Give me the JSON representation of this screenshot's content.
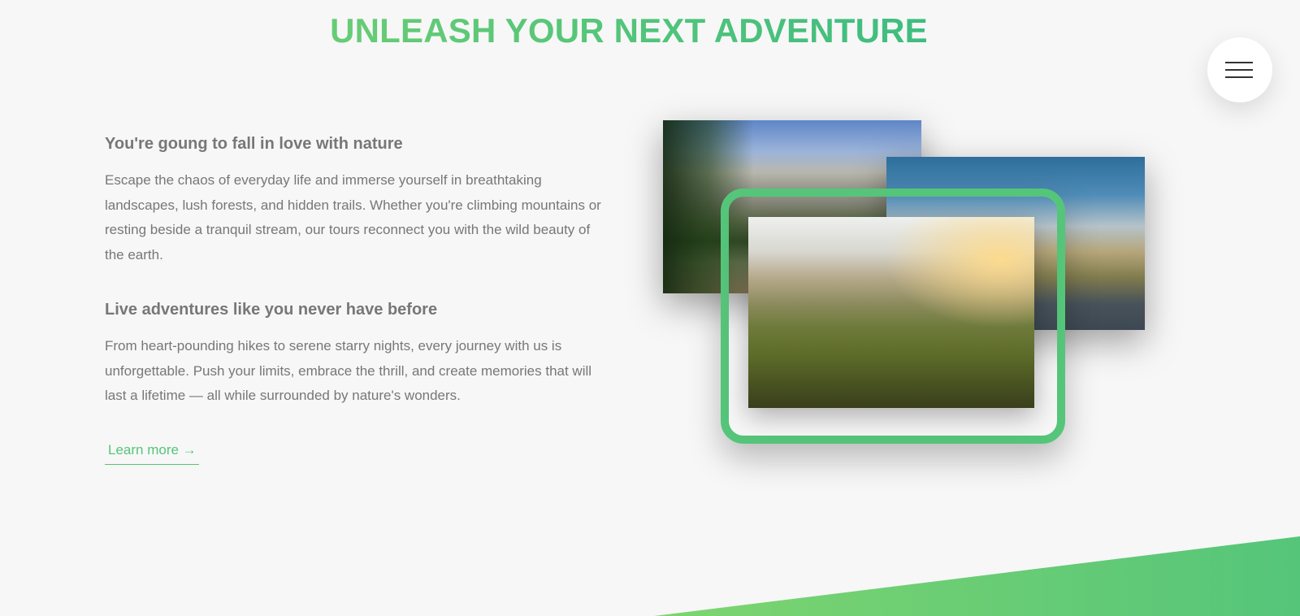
{
  "page": {
    "heading": "UNLEASH YOUR NEXT ADVENTURE"
  },
  "nav": {
    "icon": "hamburger-menu-icon"
  },
  "about": {
    "subheading_1": "You're goung to fall in love with nature",
    "paragraph_1": "Escape the chaos of everyday life and immerse yourself in breathtaking landscapes, lush forests, and hidden trails. Whether you're climbing mountains or resting beside a tranquil stream, our tours reconnect you with the wild beauty of the earth.",
    "subheading_2": "Live adventures like you never have before",
    "paragraph_2": "From heart-pounding hikes to serene starry nights, every journey with us is unforgettable. Push your limits, embrace the thrill, and create memories that will last a lifetime — all while surrounded by nature's wonders.",
    "link_label": "Learn more →"
  },
  "composition": {
    "photos": [
      "forest-cliffs-photo",
      "coastal-road-photo",
      "mountain-ridge-hiker-photo"
    ]
  },
  "colors": {
    "accent_light": "#7ed56f",
    "accent": "#55c57a",
    "accent_dark": "#28b485",
    "background": "#f7f7f7",
    "text": "#777777"
  }
}
